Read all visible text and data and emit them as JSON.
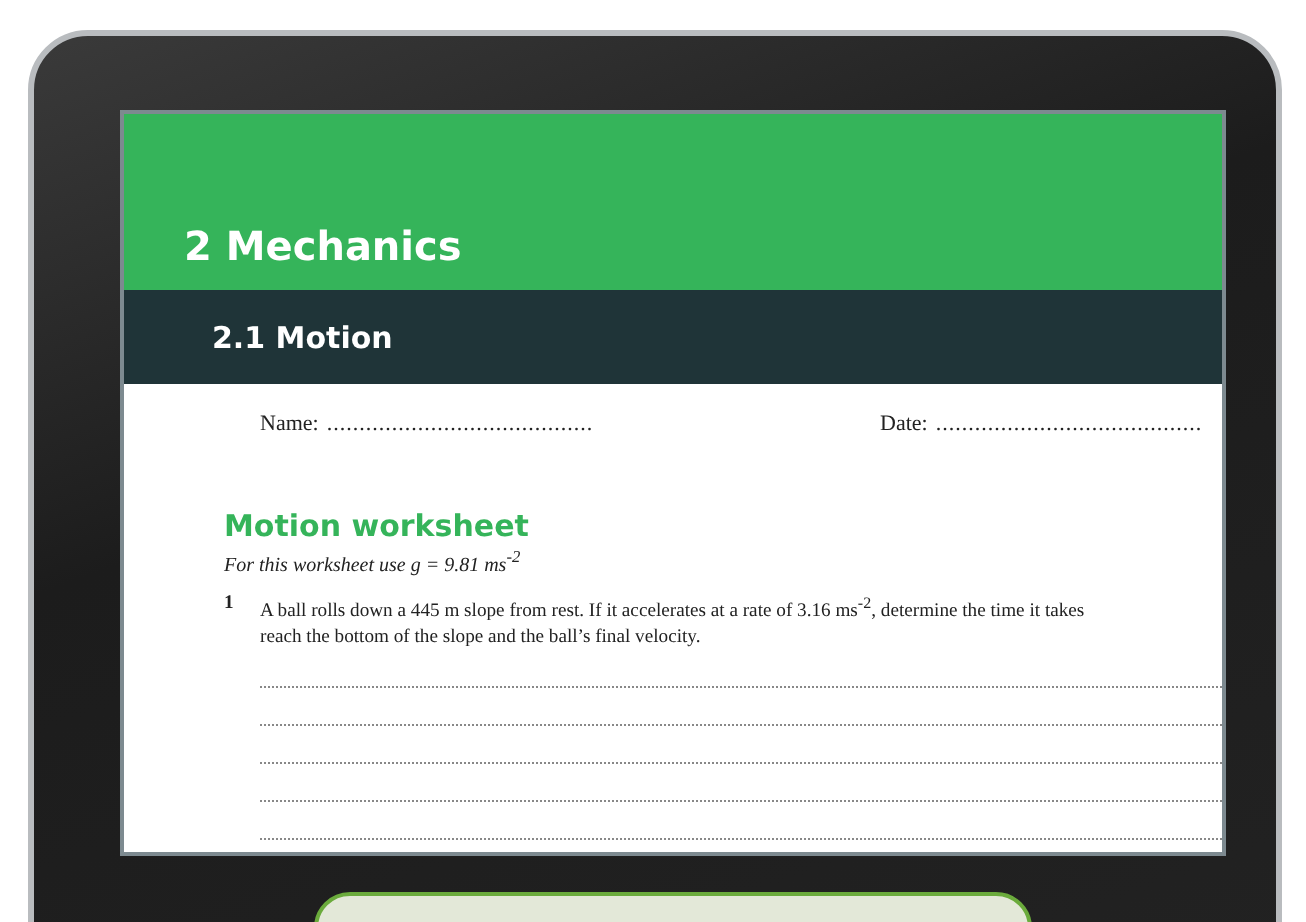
{
  "chapter": {
    "title": "2 Mechanics"
  },
  "section": {
    "title": "2.1 Motion"
  },
  "fields": [
    {
      "label": "Name:",
      "line": "........................................."
    },
    {
      "label": "Date:",
      "line": "........................................."
    }
  ],
  "worksheet": {
    "title": "Motion worksheet",
    "note": "For this worksheet use g = 9.81 ms$^{-2}$"
  },
  "questions": [
    {
      "number": "1",
      "lines": [
        "A ball rolls down a 445 m slope from rest.  If it accelerates at a rate of 3.16 ms$^{-2}$, determine the time it takes",
        "reach the bottom of the slope and the ball’s final velocity."
      ]
    }
  ]
}
